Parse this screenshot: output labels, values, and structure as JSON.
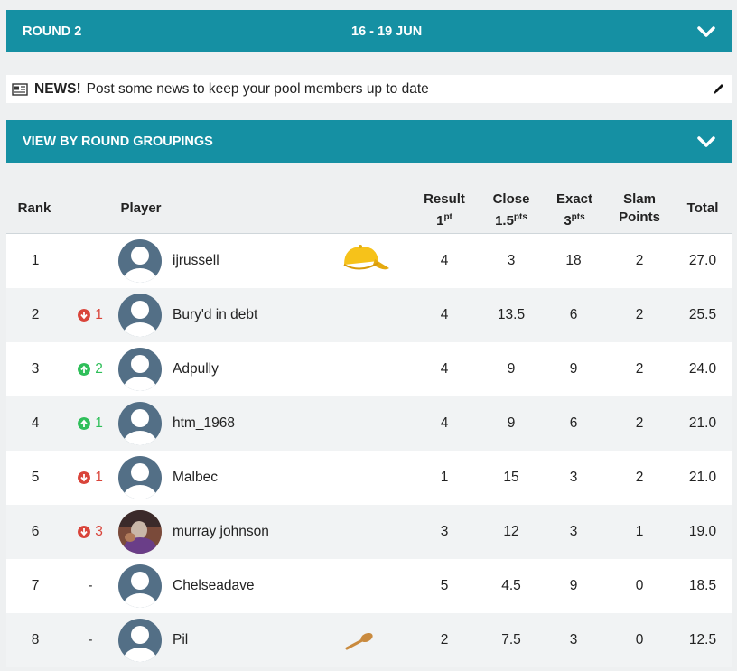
{
  "round_bar": {
    "label": "ROUND 2",
    "dates": "16 - 19 JUN"
  },
  "news": {
    "bold": "NEWS!",
    "text": "Post some news to keep your pool members up to date"
  },
  "group_bar": {
    "label": "VIEW BY ROUND GROUPINGS"
  },
  "table": {
    "headers": {
      "rank": "Rank",
      "player": "Player",
      "result": "Result",
      "result_pts": "1",
      "result_unit": "pt",
      "close": "Close",
      "close_pts": "1.5",
      "close_unit": "pts",
      "exact": "Exact",
      "exact_pts": "3",
      "exact_unit": "pts",
      "slam1": "Slam",
      "slam2": "Points",
      "total": "Total"
    },
    "rows": [
      {
        "rank": "1",
        "move": "",
        "dir": "none",
        "name": "ijrussell",
        "badge": "cap-icon",
        "result": "4",
        "close": "3",
        "exact": "18",
        "slam": "2",
        "total": "27.0"
      },
      {
        "rank": "2",
        "move": "1",
        "dir": "down",
        "name": "Bury'd in debt",
        "badge": "",
        "result": "4",
        "close": "13.5",
        "exact": "6",
        "slam": "2",
        "total": "25.5"
      },
      {
        "rank": "3",
        "move": "2",
        "dir": "up",
        "name": "Adpully",
        "badge": "",
        "result": "4",
        "close": "9",
        "exact": "9",
        "slam": "2",
        "total": "24.0"
      },
      {
        "rank": "4",
        "move": "1",
        "dir": "up",
        "name": "htm_1968",
        "badge": "",
        "result": "4",
        "close": "9",
        "exact": "6",
        "slam": "2",
        "total": "21.0"
      },
      {
        "rank": "5",
        "move": "1",
        "dir": "down",
        "name": "Malbec",
        "badge": "",
        "result": "1",
        "close": "15",
        "exact": "3",
        "slam": "2",
        "total": "21.0"
      },
      {
        "rank": "6",
        "move": "3",
        "dir": "down",
        "name": "murray johnson",
        "badge": "",
        "photo": true,
        "result": "3",
        "close": "12",
        "exact": "3",
        "slam": "1",
        "total": "19.0"
      },
      {
        "rank": "7",
        "move": "-",
        "dir": "none",
        "name": "Chelseadave",
        "badge": "",
        "result": "5",
        "close": "4.5",
        "exact": "9",
        "slam": "0",
        "total": "18.5"
      },
      {
        "rank": "8",
        "move": "-",
        "dir": "none",
        "name": "Pil",
        "badge": "wooden-spoon-icon",
        "result": "2",
        "close": "7.5",
        "exact": "3",
        "slam": "0",
        "total": "12.5"
      }
    ]
  },
  "colors": {
    "accent": "#1590a3",
    "up": "#2fbf5a",
    "down": "#d9443a"
  }
}
